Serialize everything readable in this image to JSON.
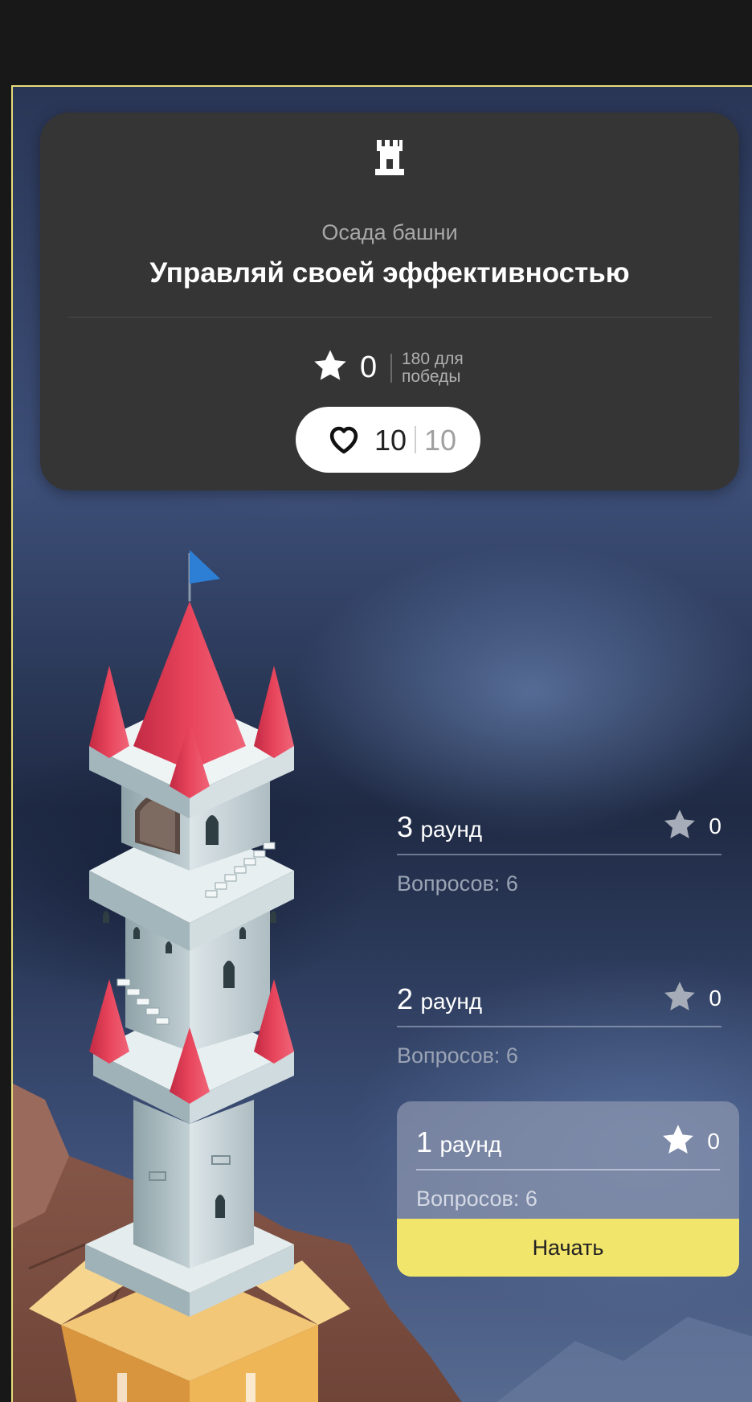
{
  "header": {
    "icon": "tower-icon",
    "subtitle": "Осада башни",
    "title": "Управляй своей эффективностью",
    "score": {
      "value": "0",
      "goal_line1": "180 для",
      "goal_line2": "победы"
    },
    "lives": {
      "current": "10",
      "max": "10"
    }
  },
  "rounds": [
    {
      "number": "3",
      "word": "раунд",
      "stars": "0",
      "questions": "Вопросов: 6"
    },
    {
      "number": "2",
      "word": "раунд",
      "stars": "0",
      "questions": "Вопросов: 6"
    },
    {
      "number": "1",
      "word": "раунд",
      "stars": "0",
      "questions": "Вопросов: 6",
      "start_label": "Начать"
    }
  ],
  "colors": {
    "accent": "#f2e56c",
    "card": "#353535",
    "roof": "#e23a52",
    "flag": "#2d7fd6"
  }
}
